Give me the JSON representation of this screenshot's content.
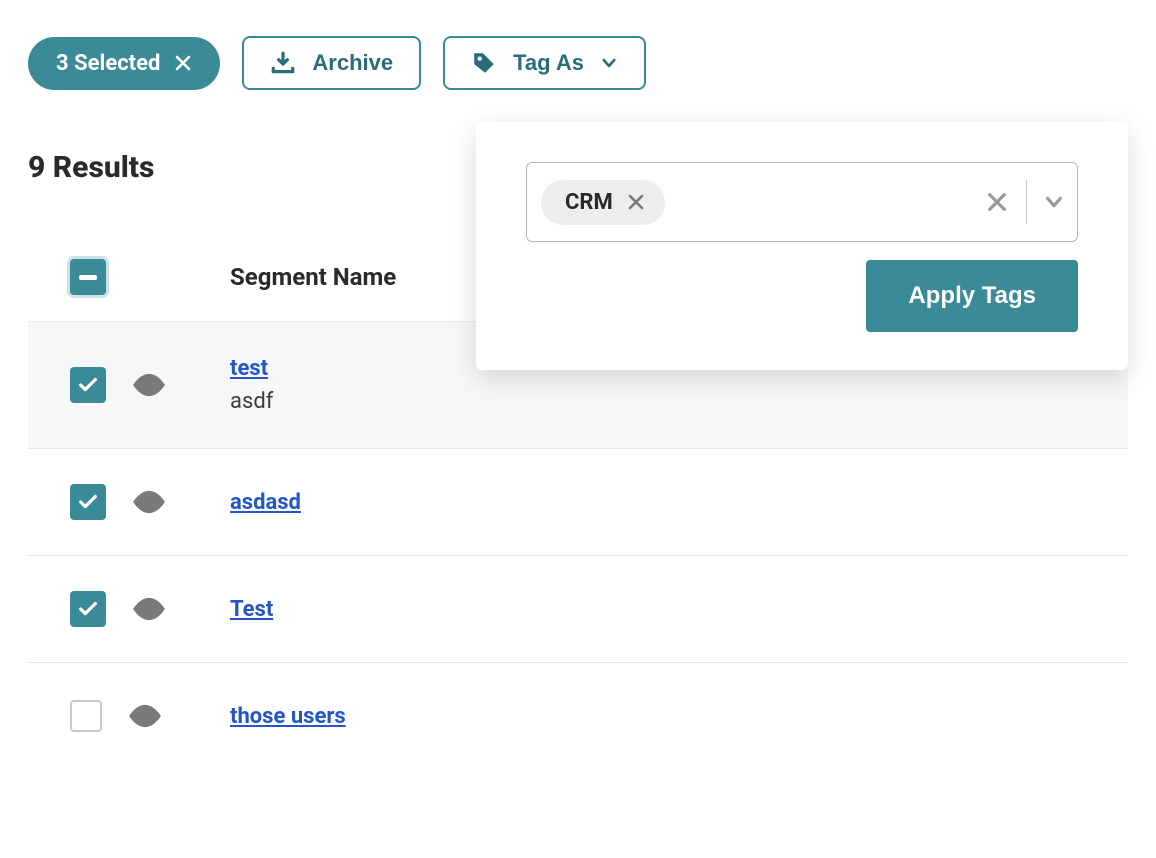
{
  "toolbar": {
    "selected_count_label": "3 Selected",
    "archive_label": "Archive",
    "tagas_label": "Tag As"
  },
  "results": {
    "header_label": "9 Results"
  },
  "table": {
    "col_segment_name": "Segment Name",
    "rows": [
      {
        "selected": true,
        "name": "test",
        "subtitle": "asdf",
        "highlight": true
      },
      {
        "selected": true,
        "name": "asdasd",
        "subtitle": null
      },
      {
        "selected": true,
        "name": "Test",
        "subtitle": null
      },
      {
        "selected": false,
        "name": "those users",
        "subtitle": null
      }
    ]
  },
  "popover": {
    "tags": [
      "CRM"
    ],
    "apply_label": "Apply Tags"
  }
}
